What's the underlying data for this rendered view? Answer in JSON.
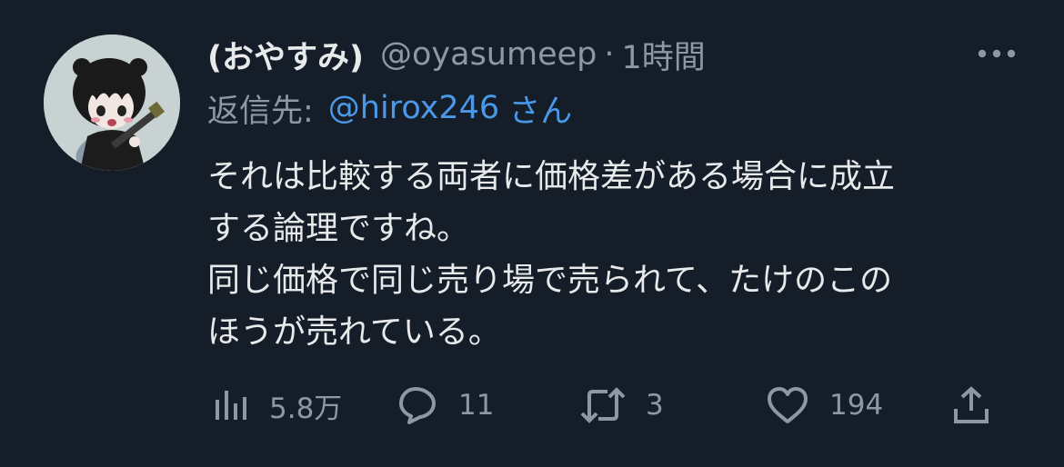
{
  "tweet": {
    "display_name": "(おやすみ)",
    "handle": "@oyasumeep",
    "separator": "·",
    "time": "1時間",
    "more_icon": "more-dots-icon",
    "reply_prefix": "返信先:",
    "reply_to": "@hirox246",
    "reply_suffix": "さん",
    "body_lines": [
      "それは比較する両者に価格差がある場合に成立",
      "する論理ですね。",
      "同じ価格で同じ売り場で売られて、たけのこの",
      "ほうが売れている。"
    ]
  },
  "actions": {
    "views": {
      "icon": "views-bar-chart-icon",
      "count": "5.8万"
    },
    "replies": {
      "icon": "reply-bubble-icon",
      "count": "11"
    },
    "retweets": {
      "icon": "retweet-icon",
      "count": "3"
    },
    "likes": {
      "icon": "heart-icon",
      "count": "194"
    },
    "share": {
      "icon": "share-icon"
    }
  },
  "colors": {
    "background": "#151d28",
    "text_primary": "#e7e9ea",
    "text_secondary": "#8b98a5",
    "link": "#4a99e9"
  }
}
